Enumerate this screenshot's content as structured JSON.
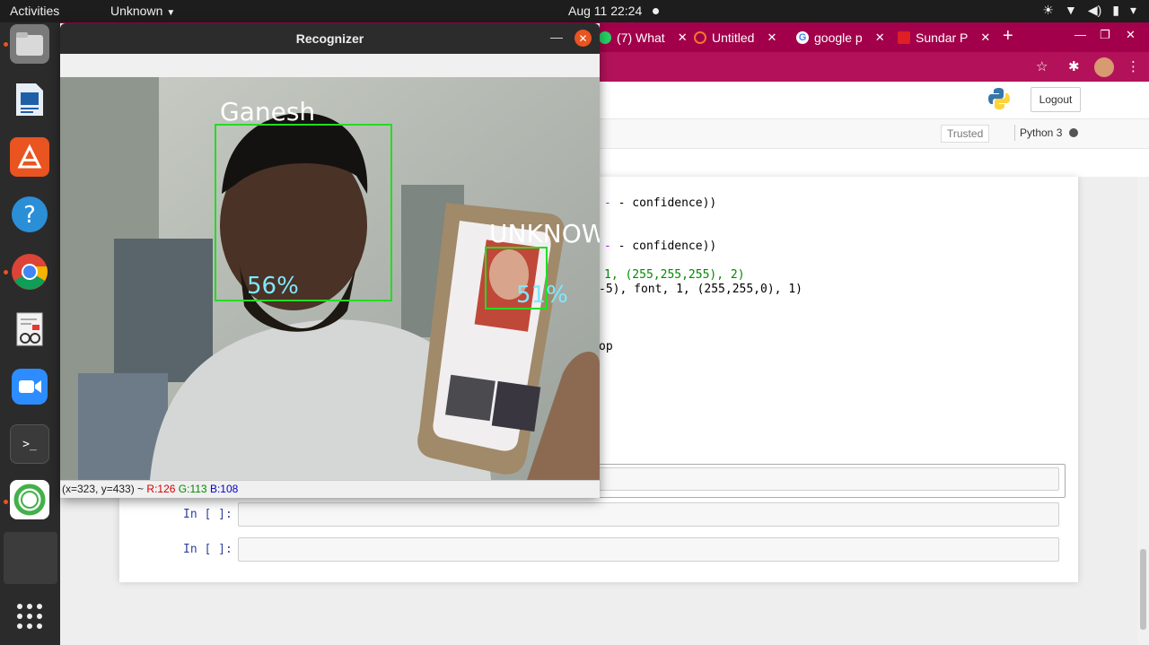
{
  "topbar": {
    "activities": "Activities",
    "app_menu": "Unknown",
    "clock": "Aug 11  22:24"
  },
  "chrome": {
    "tabs": [
      {
        "label": "(7) What",
        "fav_color": "#25d366"
      },
      {
        "label": "Untitled",
        "fav_color": "#f37726"
      },
      {
        "label": "google p",
        "fav_color": "#ffffff"
      },
      {
        "label": "Sundar P",
        "fav_color": "#e01e26"
      }
    ],
    "new_tab": "+"
  },
  "jupyter": {
    "logout": "Logout",
    "trusted": "Trusted",
    "kernel": "Python 3",
    "code": [
      {
        "text": "- confidence))"
      },
      {
        "text": "- confidence))"
      },
      {
        "text": "1, (255,255,255), 2)"
      },
      {
        "text": "-5), font, 1, (255,255,0), 1)"
      },
      {
        "text": "op"
      }
    ],
    "prompts": [
      "In [ ]:",
      "In [ ]:"
    ]
  },
  "recognizer": {
    "title": "Recognizer",
    "faces": [
      {
        "name": "Ganesh",
        "confidence": "56%"
      },
      {
        "name": "UNKNOWN",
        "confidence": "51%"
      }
    ],
    "status": {
      "coords": "(x=323, y=433) ~",
      "r": "R:126",
      "g": "G:113",
      "b": "B:108"
    }
  }
}
